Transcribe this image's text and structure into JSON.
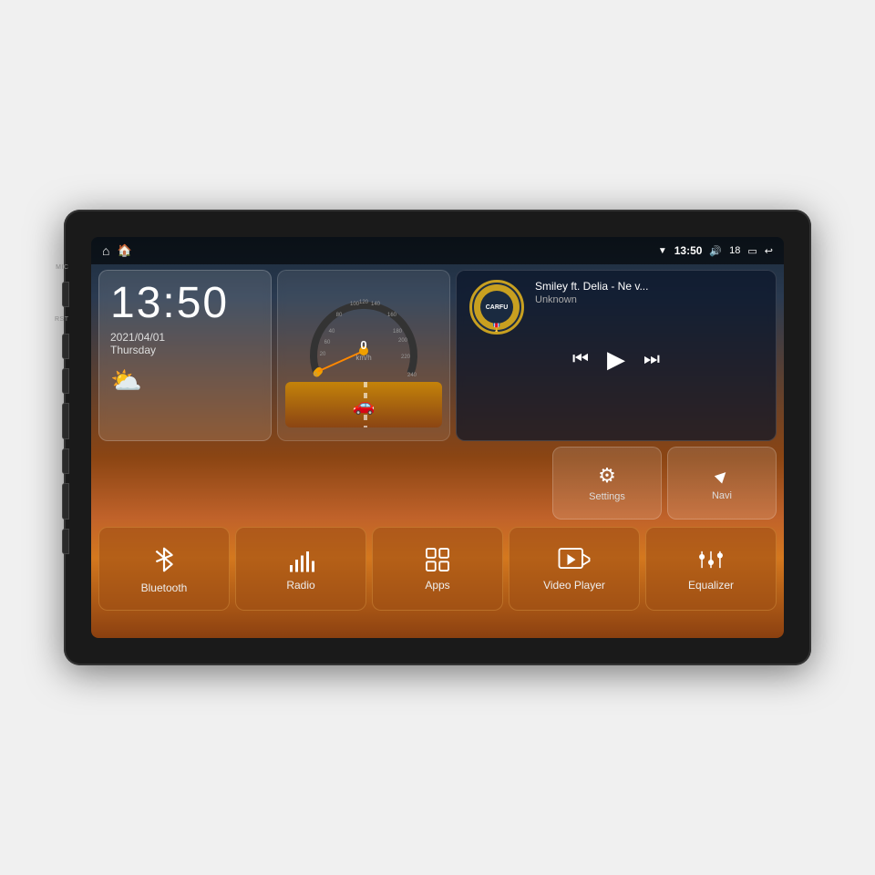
{
  "device": {
    "side_labels": [
      "MIC",
      "RST"
    ],
    "screen": {
      "status_bar": {
        "home_icon": "⌂",
        "map_icon": "🏠",
        "wifi_icon": "▼",
        "time": "13:50",
        "volume_icon": "🔊",
        "volume_level": "18",
        "battery_icon": "▭",
        "back_icon": "↩"
      },
      "clock_widget": {
        "time": "13:50",
        "date": "2021/04/01",
        "day": "Thursday",
        "weather": "⛅"
      },
      "speedometer": {
        "speed": "0",
        "unit": "km/h"
      },
      "music_widget": {
        "title": "Smiley ft. Delia - Ne v...",
        "artist": "Unknown",
        "album_text": "CARFU"
      },
      "app_tiles": [
        {
          "id": "settings",
          "label": "Settings",
          "icon": "⚙"
        },
        {
          "id": "navi",
          "label": "Navi",
          "icon": "▲"
        }
      ],
      "bottom_tiles": [
        {
          "id": "bluetooth",
          "label": "Bluetooth",
          "icon": "bluetooth"
        },
        {
          "id": "radio",
          "label": "Radio",
          "icon": "radio"
        },
        {
          "id": "apps",
          "label": "Apps",
          "icon": "apps"
        },
        {
          "id": "video",
          "label": "Video Player",
          "icon": "video"
        },
        {
          "id": "equalizer",
          "label": "Equalizer",
          "icon": "equalizer"
        }
      ]
    }
  }
}
